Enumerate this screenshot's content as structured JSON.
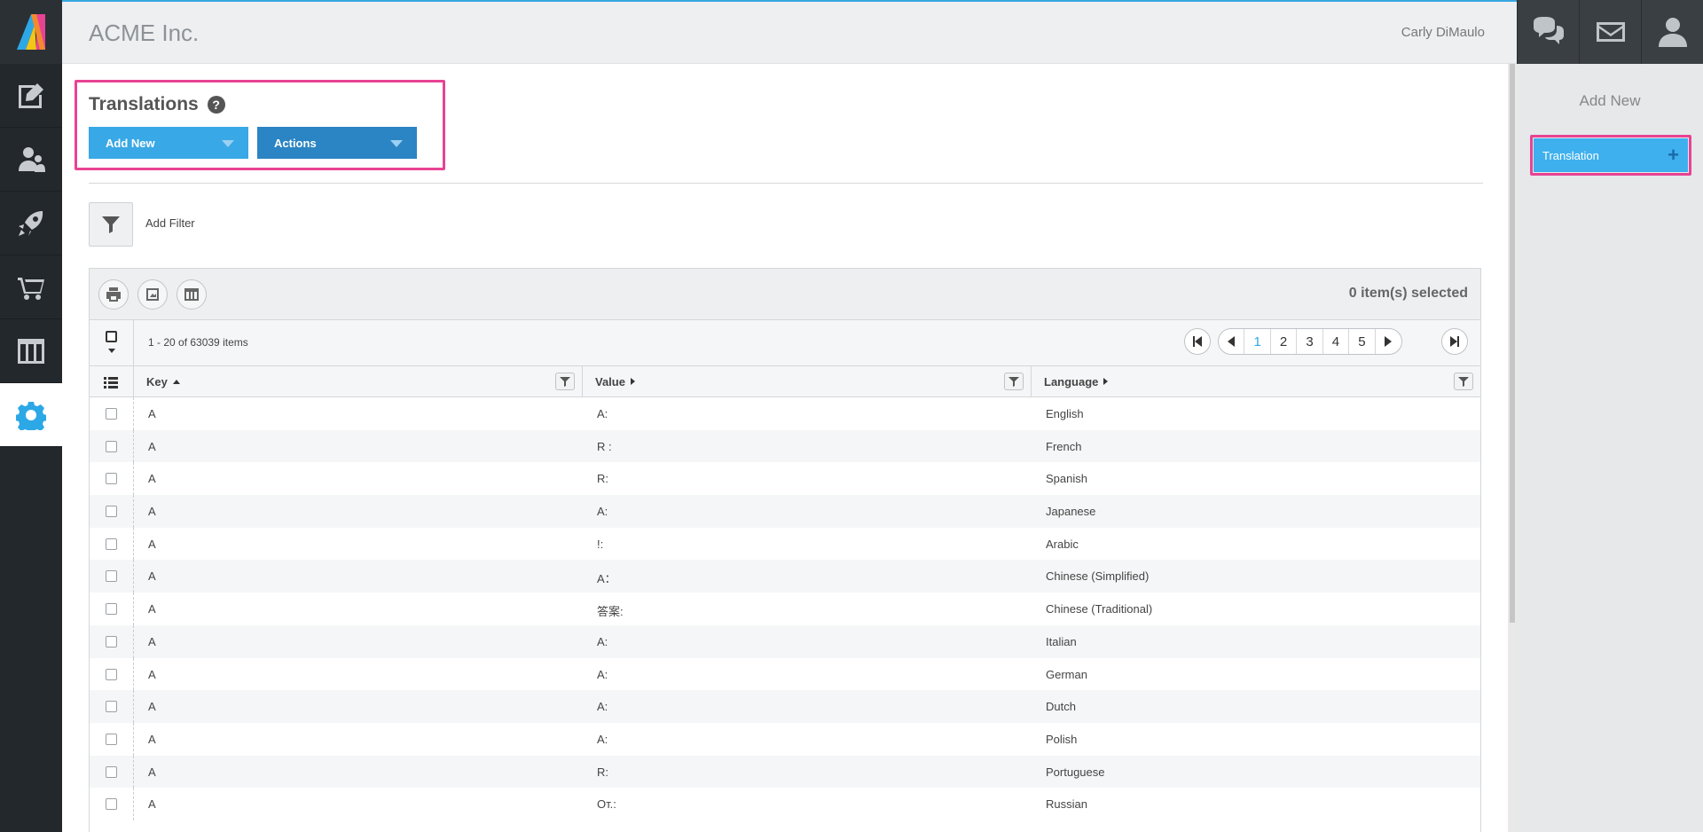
{
  "header": {
    "brand": "ACME Inc.",
    "username": "Carly DiMaulo"
  },
  "page": {
    "title": "Translations",
    "help": "?",
    "add_new_label": "Add New",
    "actions_label": "Actions",
    "add_filter_label": "Add Filter"
  },
  "right_panel": {
    "title": "Add New",
    "button_label": "Translation",
    "button_plus": "+"
  },
  "grid": {
    "selected_text": "0 item(s) selected",
    "items_count": "1 - 20 of 63039 items",
    "pages": [
      "1",
      "2",
      "3",
      "4",
      "5"
    ],
    "current_page": "1",
    "columns": [
      {
        "label": "Key",
        "sort": "asc"
      },
      {
        "label": "Value",
        "sort": "none"
      },
      {
        "label": "Language",
        "sort": "none"
      }
    ],
    "rows": [
      {
        "key": "A",
        "value": "A:",
        "language": "English"
      },
      {
        "key": "A",
        "value": "R :",
        "language": "French"
      },
      {
        "key": "A",
        "value": "R:",
        "language": "Spanish"
      },
      {
        "key": "A",
        "value": "A:",
        "language": "Japanese"
      },
      {
        "key": "A",
        "value": "!:",
        "language": "Arabic"
      },
      {
        "key": "A",
        "value": "A：",
        "language": "Chinese (Simplified)"
      },
      {
        "key": "A",
        "value": "答案:",
        "language": "Chinese (Traditional)"
      },
      {
        "key": "A",
        "value": "A:",
        "language": "Italian"
      },
      {
        "key": "A",
        "value": "A:",
        "language": "German"
      },
      {
        "key": "A",
        "value": "A:",
        "language": "Dutch"
      },
      {
        "key": "A",
        "value": "A:",
        "language": "Polish"
      },
      {
        "key": "A",
        "value": "R:",
        "language": "Portuguese"
      },
      {
        "key": "A",
        "value": "От.:",
        "language": "Russian"
      }
    ]
  },
  "colors": {
    "accent": "#39a8e6",
    "actions": "#2b84c3",
    "sidebar": "#23282d",
    "highlight": "#e84393"
  }
}
